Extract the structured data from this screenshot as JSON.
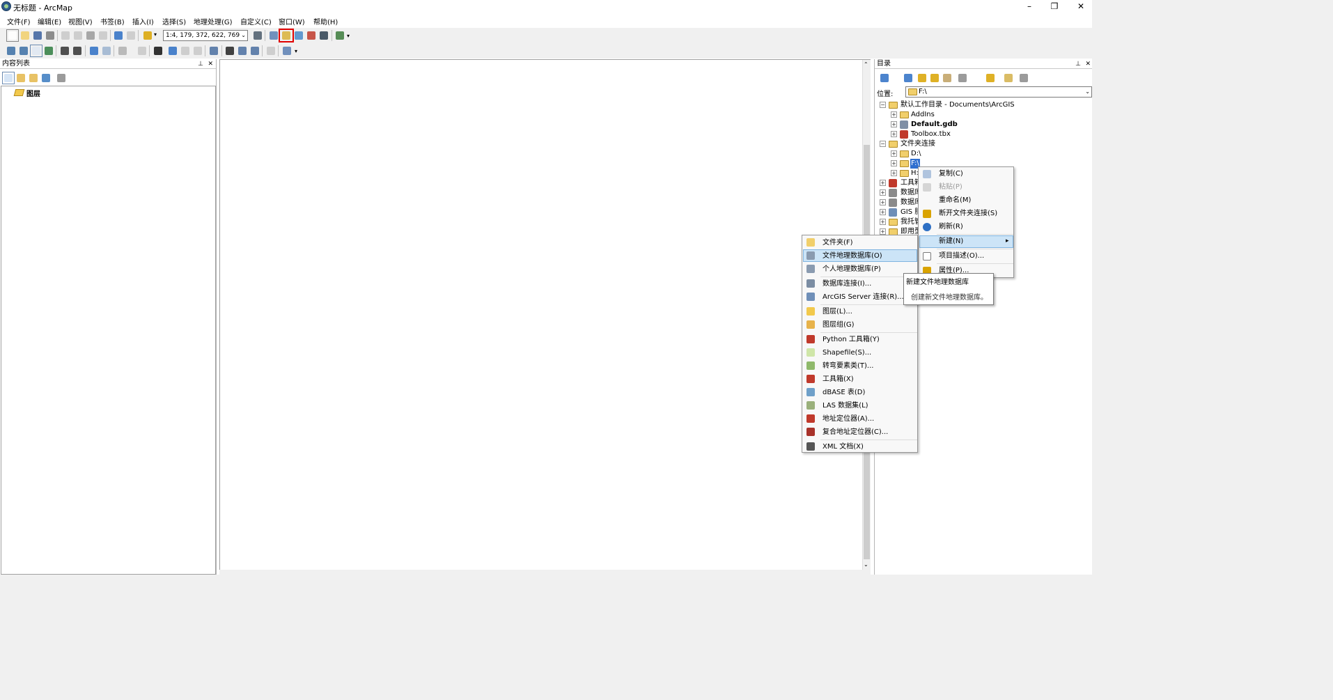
{
  "window": {
    "title": "无标题 - ArcMap",
    "minimize_glyph": "–",
    "restore_glyph": "❐",
    "close_glyph": "✕"
  },
  "menubar": [
    "文件(F)",
    "编辑(E)",
    "视图(V)",
    "书签(B)",
    "插入(I)",
    "选择(S)",
    "地理处理(G)",
    "自定义(C)",
    "窗口(W)",
    "帮助(H)"
  ],
  "toolbar": {
    "scale_value": "1:4, 179, 372, 622, 769",
    "dropdown_glyph": "⌄"
  },
  "toc": {
    "title": "内容列表",
    "pin_glyph": "✕",
    "layers_label": "图层"
  },
  "catalog": {
    "title": "目录",
    "location_label": "位置:",
    "location_value": "F:\\",
    "tree": {
      "home_folder": "默认工作目录 - Documents\\ArcGIS",
      "addins": "AddIns",
      "default_gdb": "Default.gdb",
      "toolbox": "Toolbox.tbx",
      "folder_connections": "文件夹连接",
      "drive_d": "D:\\",
      "drive_f": "F:\\",
      "drive_h": "H:",
      "toolboxes_partial": "工具箱",
      "db_servers_partial": "数据库",
      "db_connections_partial": "数据库",
      "gis_servers_partial": "GIS 服",
      "hosted_partial": "我托管",
      "ready_partial": "即用型"
    }
  },
  "context_menu": {
    "copy": "复制(C)",
    "paste": "粘贴(P)",
    "rename": "重命名(M)",
    "disconnect": "断开文件夹连接(S)",
    "refresh": "刷新(R)",
    "new": "新建(N)",
    "new_arrow": "▸",
    "item_description": "项目描述(O)...",
    "properties": "属性(P)..."
  },
  "new_submenu": [
    {
      "label": "文件夹(F)",
      "icon": "folder-icon",
      "color": "#f1cf6b"
    },
    {
      "label": "文件地理数据库(O)",
      "icon": "file-gdb-icon",
      "color": "#8a9bb0"
    },
    {
      "label": "个人地理数据库(P)",
      "icon": "personal-gdb-icon",
      "color": "#8a9bb0"
    },
    {
      "label": "数据库连接(I)...",
      "icon": "db-connection-icon",
      "color": "#7b8da3"
    },
    {
      "label": "ArcGIS Server 连接(R)...",
      "icon": "server-connection-icon",
      "color": "#6f8fb8"
    },
    {
      "label": "图层(L)...",
      "icon": "layer-icon",
      "color": "#f2c94c"
    },
    {
      "label": "图层组(G)",
      "icon": "group-layer-icon",
      "color": "#e7b24a"
    },
    {
      "label": "Python 工具箱(Y)",
      "icon": "python-toolbox-icon",
      "color": "#c0392b"
    },
    {
      "label": "Shapefile(S)...",
      "icon": "shapefile-icon",
      "color": "#cfe6a8"
    },
    {
      "label": "转弯要素类(T)...",
      "icon": "turn-feature-icon",
      "color": "#8fb96b"
    },
    {
      "label": "工具箱(X)",
      "icon": "toolbox-icon",
      "color": "#c0392b"
    },
    {
      "label": "dBASE 表(D)",
      "icon": "dbase-table-icon",
      "color": "#6fa0c9"
    },
    {
      "label": "LAS 数据集(L)",
      "icon": "las-dataset-icon",
      "color": "#9ab07b"
    },
    {
      "label": "地址定位器(A)...",
      "icon": "address-locator-icon",
      "color": "#c0392b"
    },
    {
      "label": "复合地址定位器(C)...",
      "icon": "composite-locator-icon",
      "color": "#a8322a"
    },
    {
      "label": "XML 文档(X)",
      "icon": "xml-doc-icon",
      "color": "#555555"
    }
  ],
  "tooltip": {
    "title": "新建文件地理数据库",
    "body": "创建新文件地理数据库。"
  }
}
